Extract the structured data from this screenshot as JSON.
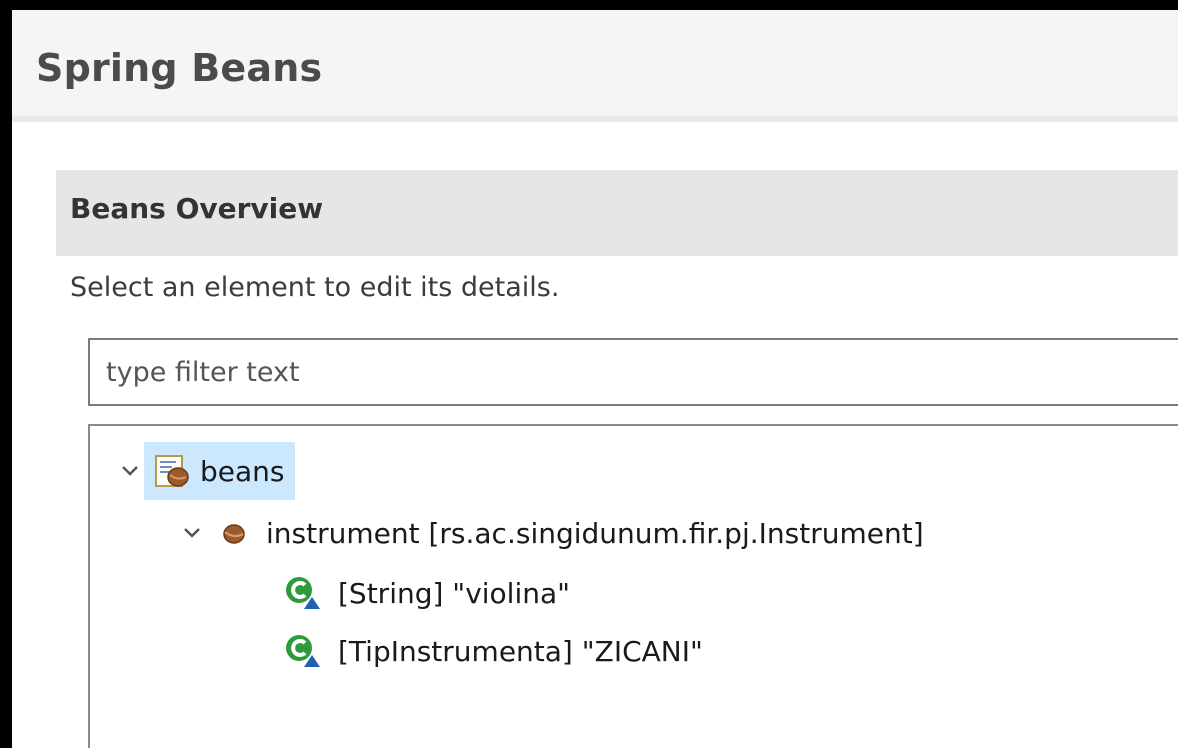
{
  "editor": {
    "title": "Spring Beans"
  },
  "section": {
    "title": "Beans Overview",
    "description": "Select an element to edit its details."
  },
  "filter": {
    "placeholder": "type filter text",
    "value": ""
  },
  "tree": {
    "root": {
      "label": "beans",
      "icon": "beans-file-icon",
      "expanded": true,
      "selected": true
    },
    "bean": {
      "label": "instrument [rs.ac.singidunum.fir.pj.Instrument]",
      "icon": "bean-icon",
      "expanded": true
    },
    "args": [
      {
        "label": "[String] \"violina\"",
        "icon": "constructor-arg-icon"
      },
      {
        "label": "[TipInstrumenta] \"ZICANI\"",
        "icon": "constructor-arg-icon"
      }
    ]
  },
  "colors": {
    "selection": "#cce8ff",
    "section_header_bg": "#e6e6e6",
    "bean_brown": "#8b5a2b",
    "arg_green": "#2e9b3a",
    "arg_blue": "#1f5fb4"
  }
}
